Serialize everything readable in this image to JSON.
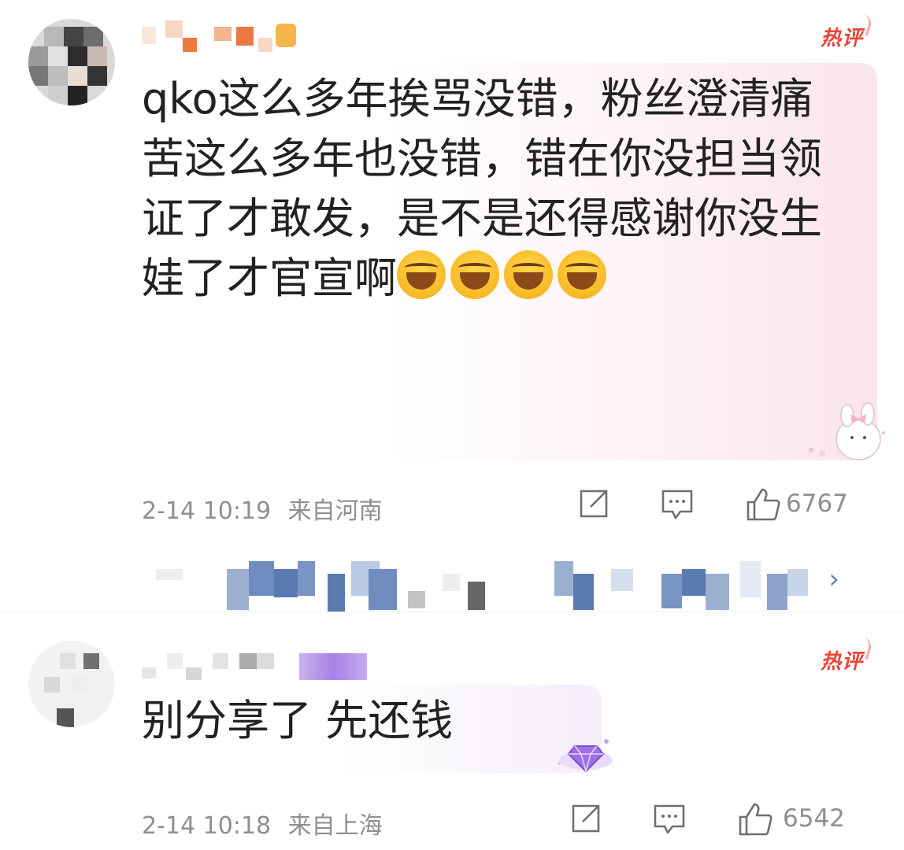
{
  "comments": [
    {
      "badge": "热评",
      "text": "qko这么多年挨骂没错，粉丝澄清痛苦这么多年也没错，错在你没担当领证了才敢发，是不是还得感谢你没生娃了才官宣啊",
      "emoji_count": 4,
      "time": "2-14 10:19",
      "location": "来自河南",
      "likes": "6767"
    },
    {
      "badge": "热评",
      "text": "别分享了 先还钱",
      "time": "2-14 10:18",
      "location": "来自上海",
      "likes": "6542"
    }
  ],
  "icons": {
    "share": "share-icon",
    "comment": "comment-icon",
    "like": "thumbs-up-icon",
    "expand": "chevron-right-icon"
  },
  "colors": {
    "badge": "#e8443a",
    "meta": "#8f8f8f",
    "reply_link": "#5b7bb0"
  }
}
